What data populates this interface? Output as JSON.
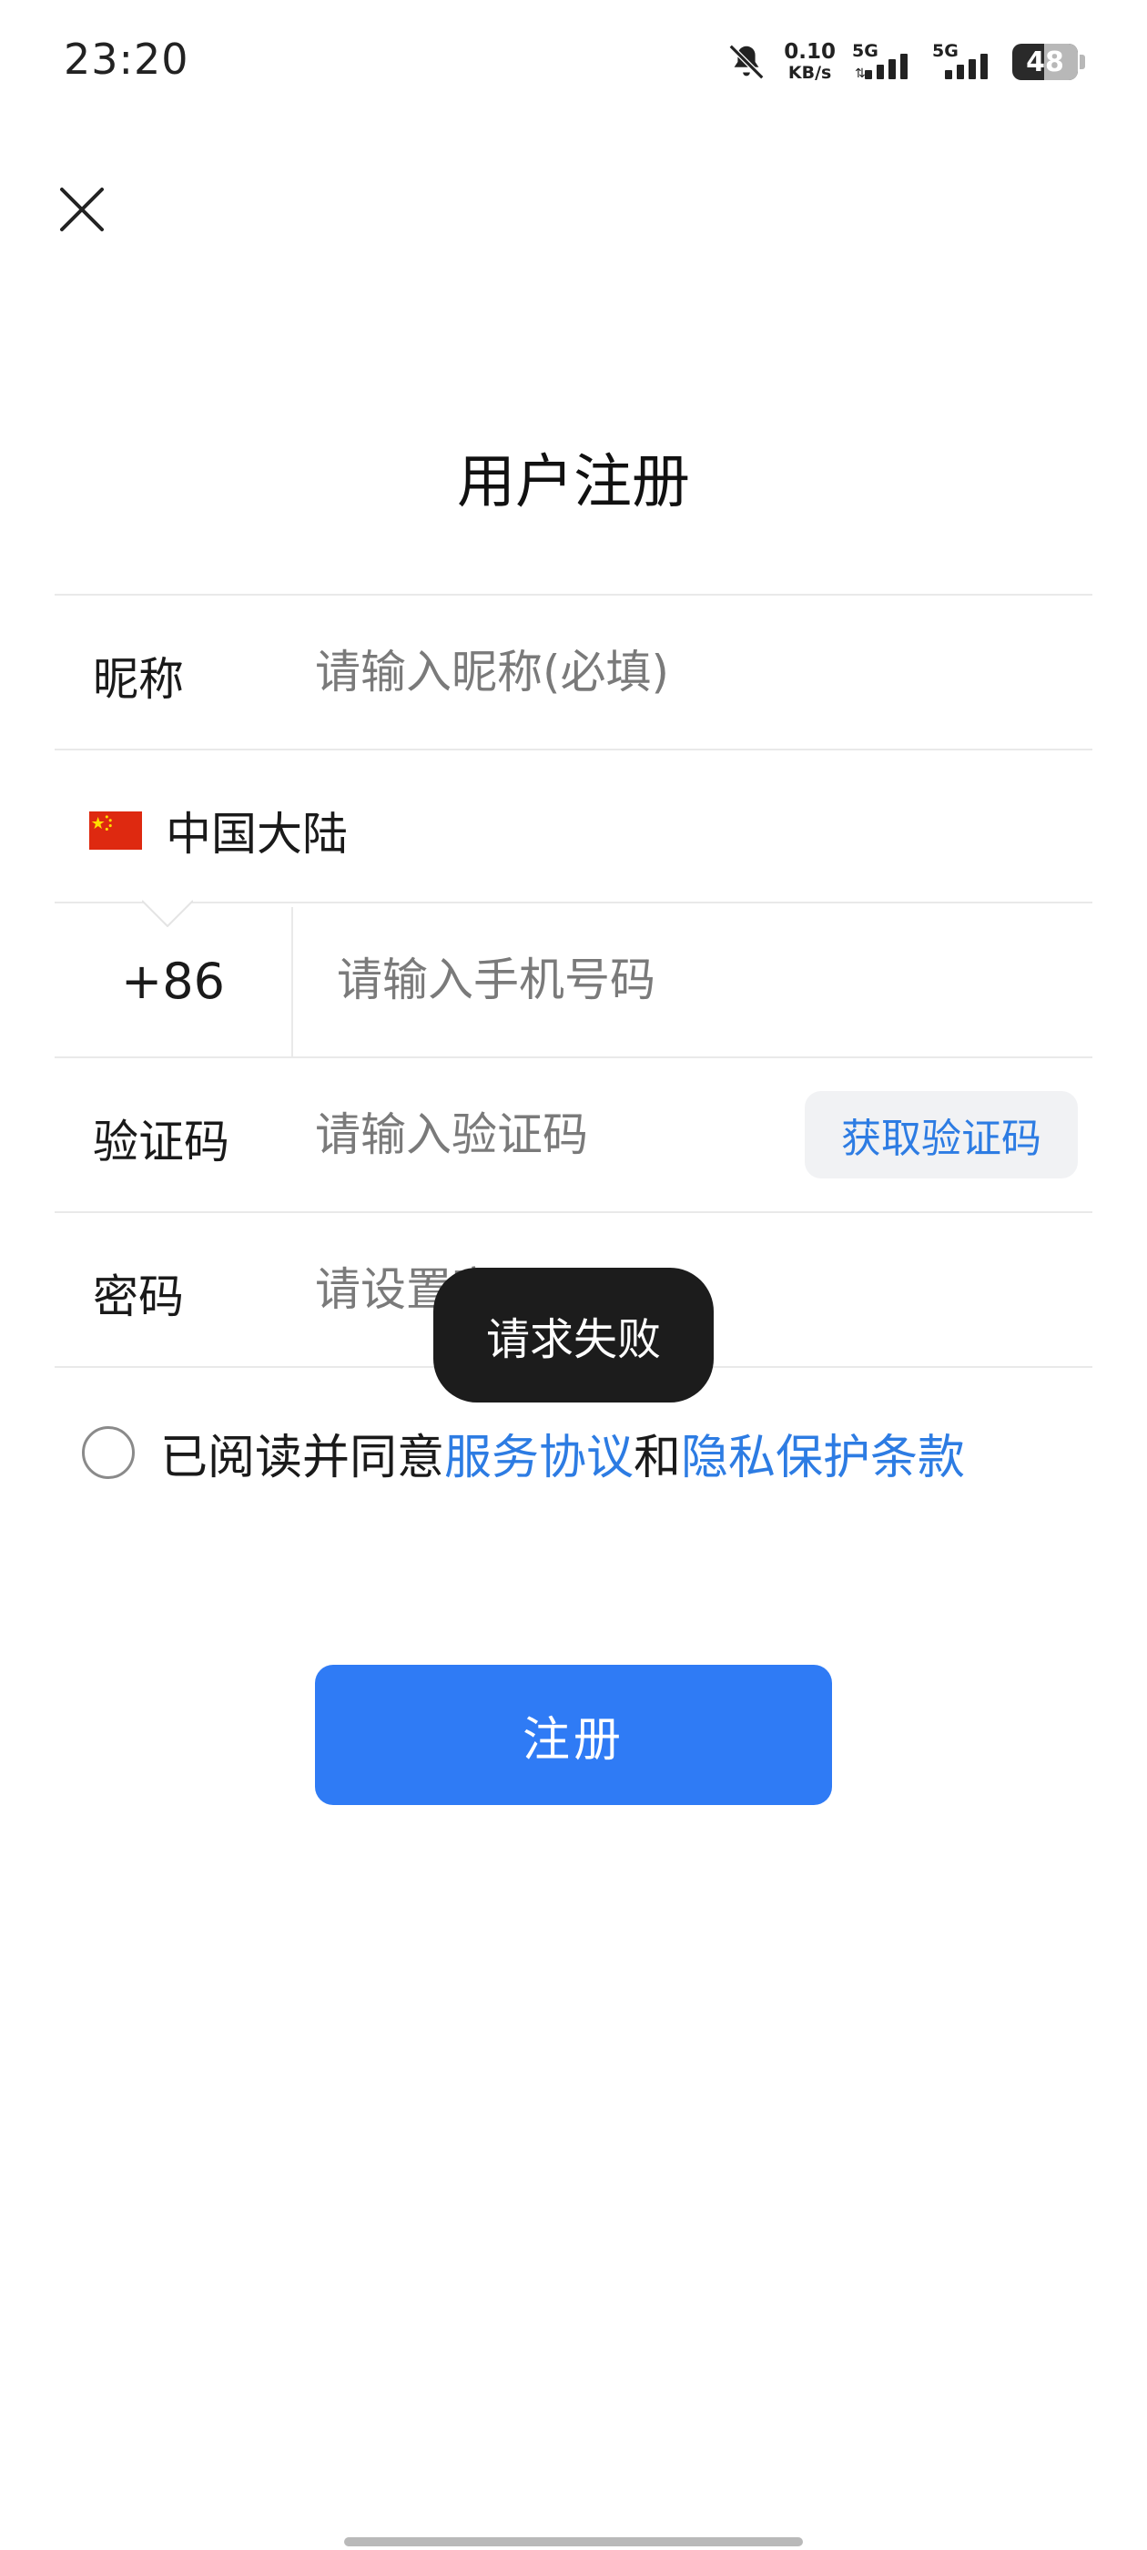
{
  "status_bar": {
    "time": "23:20",
    "network_speed_value": "0.10",
    "network_speed_unit": "KB/s",
    "sim1_label": "5G",
    "sim2_label": "5G",
    "battery_level": "48",
    "icons": [
      "bell-muted-icon",
      "signal-icon",
      "battery-icon"
    ]
  },
  "header": {
    "title": "用户注册"
  },
  "form": {
    "nickname": {
      "label": "昵称",
      "placeholder": "请输入昵称(必填)",
      "value": ""
    },
    "country": {
      "name": "中国大陆",
      "flag": "china-flag-icon"
    },
    "phone": {
      "code": "+86",
      "placeholder": "请输入手机号码",
      "value": ""
    },
    "verification": {
      "label": "验证码",
      "placeholder": "请输入验证码",
      "value": "",
      "button_label": "获取验证码"
    },
    "password": {
      "label": "密码",
      "placeholder": "请设置密码",
      "value": ""
    }
  },
  "agreement": {
    "checked": false,
    "prefix": "已阅读并同意",
    "service_link": "服务协议",
    "conjunction": "和",
    "privacy_link": "隐私保护条款"
  },
  "actions": {
    "register_label": "注册"
  },
  "toast": {
    "message": "请求失败"
  },
  "colors": {
    "accent": "#2f7bf5",
    "link": "#2d7ce3",
    "toast_bg": "#1c1c1c"
  }
}
